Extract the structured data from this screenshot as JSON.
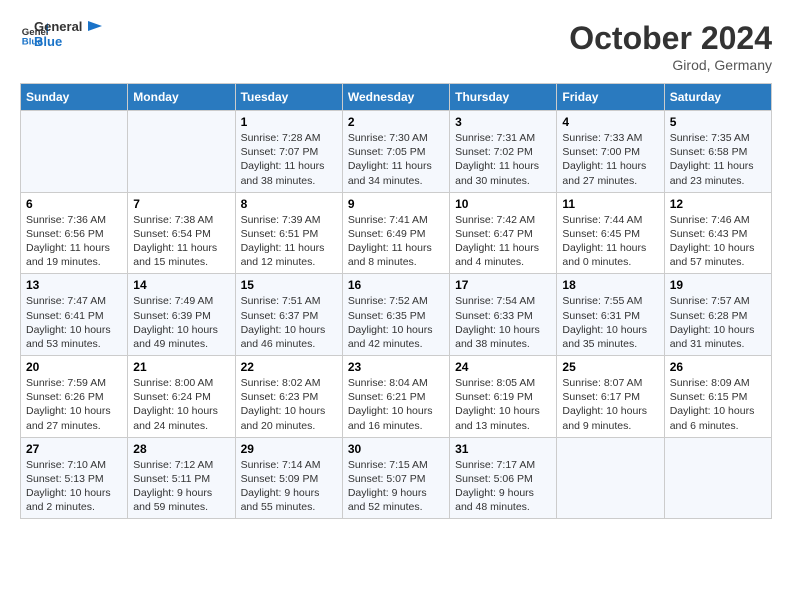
{
  "header": {
    "logo_general": "General",
    "logo_blue": "Blue",
    "month": "October 2024",
    "location": "Girod, Germany"
  },
  "weekdays": [
    "Sunday",
    "Monday",
    "Tuesday",
    "Wednesday",
    "Thursday",
    "Friday",
    "Saturday"
  ],
  "weeks": [
    [
      {
        "day": "",
        "info": ""
      },
      {
        "day": "",
        "info": ""
      },
      {
        "day": "1",
        "info": "Sunrise: 7:28 AM\nSunset: 7:07 PM\nDaylight: 11 hours\nand 38 minutes."
      },
      {
        "day": "2",
        "info": "Sunrise: 7:30 AM\nSunset: 7:05 PM\nDaylight: 11 hours\nand 34 minutes."
      },
      {
        "day": "3",
        "info": "Sunrise: 7:31 AM\nSunset: 7:02 PM\nDaylight: 11 hours\nand 30 minutes."
      },
      {
        "day": "4",
        "info": "Sunrise: 7:33 AM\nSunset: 7:00 PM\nDaylight: 11 hours\nand 27 minutes."
      },
      {
        "day": "5",
        "info": "Sunrise: 7:35 AM\nSunset: 6:58 PM\nDaylight: 11 hours\nand 23 minutes."
      }
    ],
    [
      {
        "day": "6",
        "info": "Sunrise: 7:36 AM\nSunset: 6:56 PM\nDaylight: 11 hours\nand 19 minutes."
      },
      {
        "day": "7",
        "info": "Sunrise: 7:38 AM\nSunset: 6:54 PM\nDaylight: 11 hours\nand 15 minutes."
      },
      {
        "day": "8",
        "info": "Sunrise: 7:39 AM\nSunset: 6:51 PM\nDaylight: 11 hours\nand 12 minutes."
      },
      {
        "day": "9",
        "info": "Sunrise: 7:41 AM\nSunset: 6:49 PM\nDaylight: 11 hours\nand 8 minutes."
      },
      {
        "day": "10",
        "info": "Sunrise: 7:42 AM\nSunset: 6:47 PM\nDaylight: 11 hours\nand 4 minutes."
      },
      {
        "day": "11",
        "info": "Sunrise: 7:44 AM\nSunset: 6:45 PM\nDaylight: 11 hours\nand 0 minutes."
      },
      {
        "day": "12",
        "info": "Sunrise: 7:46 AM\nSunset: 6:43 PM\nDaylight: 10 hours\nand 57 minutes."
      }
    ],
    [
      {
        "day": "13",
        "info": "Sunrise: 7:47 AM\nSunset: 6:41 PM\nDaylight: 10 hours\nand 53 minutes."
      },
      {
        "day": "14",
        "info": "Sunrise: 7:49 AM\nSunset: 6:39 PM\nDaylight: 10 hours\nand 49 minutes."
      },
      {
        "day": "15",
        "info": "Sunrise: 7:51 AM\nSunset: 6:37 PM\nDaylight: 10 hours\nand 46 minutes."
      },
      {
        "day": "16",
        "info": "Sunrise: 7:52 AM\nSunset: 6:35 PM\nDaylight: 10 hours\nand 42 minutes."
      },
      {
        "day": "17",
        "info": "Sunrise: 7:54 AM\nSunset: 6:33 PM\nDaylight: 10 hours\nand 38 minutes."
      },
      {
        "day": "18",
        "info": "Sunrise: 7:55 AM\nSunset: 6:31 PM\nDaylight: 10 hours\nand 35 minutes."
      },
      {
        "day": "19",
        "info": "Sunrise: 7:57 AM\nSunset: 6:28 PM\nDaylight: 10 hours\nand 31 minutes."
      }
    ],
    [
      {
        "day": "20",
        "info": "Sunrise: 7:59 AM\nSunset: 6:26 PM\nDaylight: 10 hours\nand 27 minutes."
      },
      {
        "day": "21",
        "info": "Sunrise: 8:00 AM\nSunset: 6:24 PM\nDaylight: 10 hours\nand 24 minutes."
      },
      {
        "day": "22",
        "info": "Sunrise: 8:02 AM\nSunset: 6:23 PM\nDaylight: 10 hours\nand 20 minutes."
      },
      {
        "day": "23",
        "info": "Sunrise: 8:04 AM\nSunset: 6:21 PM\nDaylight: 10 hours\nand 16 minutes."
      },
      {
        "day": "24",
        "info": "Sunrise: 8:05 AM\nSunset: 6:19 PM\nDaylight: 10 hours\nand 13 minutes."
      },
      {
        "day": "25",
        "info": "Sunrise: 8:07 AM\nSunset: 6:17 PM\nDaylight: 10 hours\nand 9 minutes."
      },
      {
        "day": "26",
        "info": "Sunrise: 8:09 AM\nSunset: 6:15 PM\nDaylight: 10 hours\nand 6 minutes."
      }
    ],
    [
      {
        "day": "27",
        "info": "Sunrise: 7:10 AM\nSunset: 5:13 PM\nDaylight: 10 hours\nand 2 minutes."
      },
      {
        "day": "28",
        "info": "Sunrise: 7:12 AM\nSunset: 5:11 PM\nDaylight: 9 hours\nand 59 minutes."
      },
      {
        "day": "29",
        "info": "Sunrise: 7:14 AM\nSunset: 5:09 PM\nDaylight: 9 hours\nand 55 minutes."
      },
      {
        "day": "30",
        "info": "Sunrise: 7:15 AM\nSunset: 5:07 PM\nDaylight: 9 hours\nand 52 minutes."
      },
      {
        "day": "31",
        "info": "Sunrise: 7:17 AM\nSunset: 5:06 PM\nDaylight: 9 hours\nand 48 minutes."
      },
      {
        "day": "",
        "info": ""
      },
      {
        "day": "",
        "info": ""
      }
    ]
  ]
}
